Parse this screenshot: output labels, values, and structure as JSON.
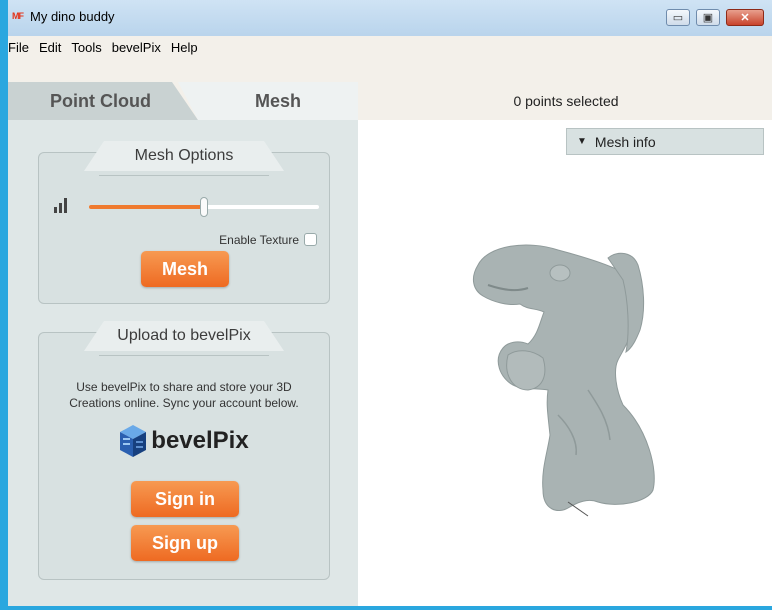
{
  "window": {
    "app_icon_text": "MF",
    "title": "My dino buddy",
    "controls": {
      "minimize": "▭",
      "maximize": "▣",
      "close": "✕"
    }
  },
  "menu": {
    "items": [
      "File",
      "Edit",
      "Tools",
      "bevelPix",
      "Help"
    ]
  },
  "tabs": {
    "point_cloud": "Point Cloud",
    "mesh": "Mesh"
  },
  "mesh_options": {
    "title": "Mesh Options",
    "slider_value": 0.5,
    "enable_texture_label": "Enable Texture",
    "enable_texture_checked": false,
    "mesh_button": "Mesh"
  },
  "upload": {
    "title": "Upload to bevelPix",
    "description": "Use bevelPix to share and store your 3D Creations online. Sync your account below.",
    "logo_text": "bevelPix",
    "sign_in": "Sign in",
    "sign_up": "Sign up"
  },
  "viewport": {
    "selection_status": "0 points selected",
    "mesh_info_label": "Mesh info",
    "mesh_color": "#a9b3b3"
  },
  "colors": {
    "accent_orange": "#ee6a22",
    "panel_bg": "#dfe7e7",
    "desktop_bg": "#2aa7df"
  }
}
